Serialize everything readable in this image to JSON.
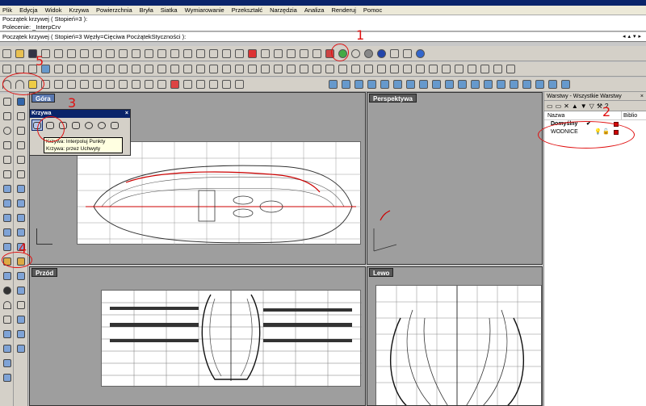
{
  "menu": [
    "Plik",
    "Edycja",
    "Widok",
    "Krzywa",
    "Powierzchnia",
    "Bryła",
    "Siatka",
    "Wymiarowanie",
    "Przekształć",
    "Narzędzia",
    "Analiza",
    "Renderuj",
    "Pomoc"
  ],
  "history": [
    "Początek krzywej ( Stopień=3 ):",
    "Polecenie: _InterpCrv"
  ],
  "command_prompt": "Początek krzywej ( Stopień=3 Węzły=Cięciwa PocżątekStyczności ):",
  "viewports": {
    "top": "Góra",
    "perspective": "Perspektywa",
    "front": "Przód",
    "left": "Lewo"
  },
  "krzywa_panel": {
    "title": "Krzywa",
    "tooltip_lines": [
      "Krzywa: Interpoluj Punkty",
      "Krzywa: przez Uchwyty"
    ]
  },
  "layers_panel": {
    "title": "Warstwy - Wszystkie Warstwy",
    "col_name": "Nazwa",
    "col_extra": "Biblio",
    "rows": [
      {
        "name": "Domyślny",
        "current": "✔"
      },
      {
        "name": "WODNICE"
      }
    ]
  },
  "annotations": [
    "1",
    "2",
    "3",
    "4",
    "5"
  ],
  "colors": {
    "annotation": "#e01010",
    "layer_color": "#d00000",
    "viewport_bg": "#9e9e9e"
  }
}
